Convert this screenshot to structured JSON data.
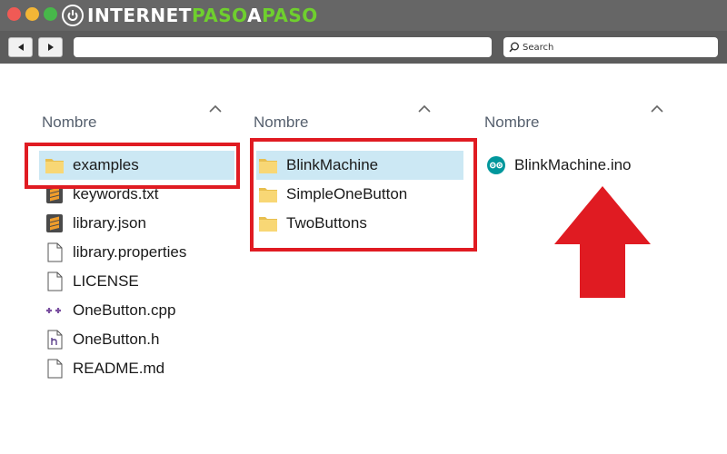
{
  "brand": {
    "part1": "INTERNET",
    "part2": "PASO",
    "part3": "A",
    "part4": "PASO"
  },
  "toolbar": {
    "search_placeholder": "Search"
  },
  "columns": [
    {
      "header": "Nombre",
      "items": [
        {
          "label": "examples",
          "icon": "folder-icon",
          "selected": true
        },
        {
          "label": "keywords.txt",
          "icon": "sublime-text-icon"
        },
        {
          "label": "library.json",
          "icon": "sublime-text-icon"
        },
        {
          "label": "library.properties",
          "icon": "file-icon"
        },
        {
          "label": "LICENSE",
          "icon": "file-icon"
        },
        {
          "label": "OneButton.cpp",
          "icon": "cpp-icon"
        },
        {
          "label": "OneButton.h",
          "icon": "header-file-icon"
        },
        {
          "label": "README.md",
          "icon": "file-icon"
        }
      ]
    },
    {
      "header": "Nombre",
      "items": [
        {
          "label": "BlinkMachine",
          "icon": "folder-icon",
          "selected": true
        },
        {
          "label": "SimpleOneButton",
          "icon": "folder-icon"
        },
        {
          "label": "TwoButtons",
          "icon": "folder-icon"
        }
      ]
    },
    {
      "header": "Nombre",
      "items": [
        {
          "label": "BlinkMachine.ino",
          "icon": "arduino-icon"
        }
      ]
    }
  ],
  "colors": {
    "highlight": "#e01b22",
    "selection": "#cce8f4",
    "folder": "#f8d775",
    "arduino": "#00979c"
  }
}
